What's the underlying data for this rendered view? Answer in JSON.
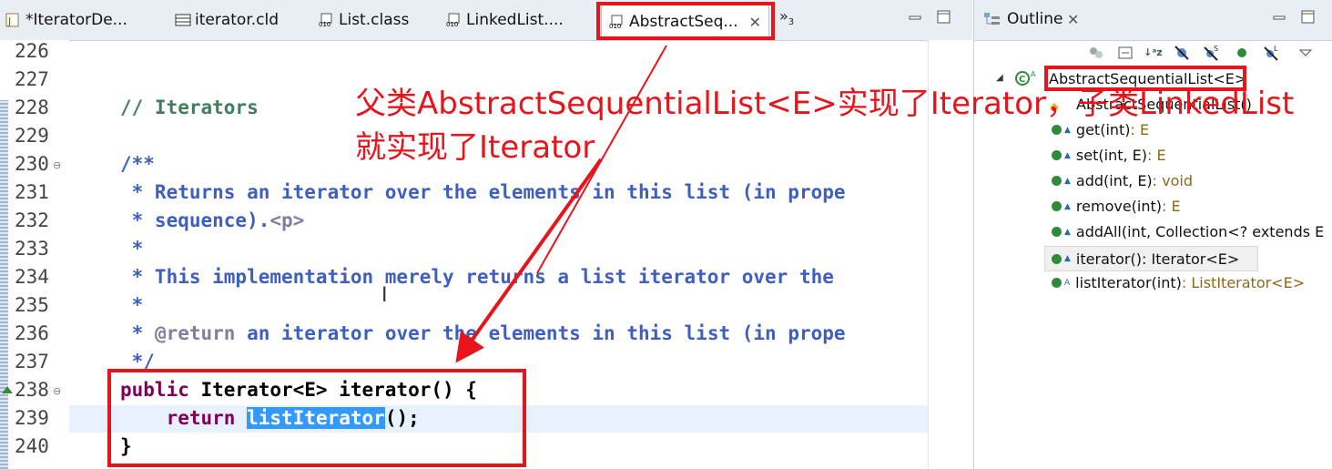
{
  "editor": {
    "tabs": [
      {
        "label": "*IteratorDe...",
        "icon": "java-file-icon"
      },
      {
        "label": "iterator.cld",
        "icon": "class-diagram-icon"
      },
      {
        "label": "List.class",
        "icon": "class-file-icon"
      },
      {
        "label": "LinkedList....",
        "icon": "class-file-icon"
      },
      {
        "label": "AbstractSeq...",
        "icon": "class-file-icon",
        "active": true
      }
    ],
    "close_glyph": "✕",
    "overflow": {
      "glyph": "»",
      "count": "3"
    },
    "lines": [
      {
        "n": "226",
        "text": ""
      },
      {
        "n": "227",
        "text": ""
      },
      {
        "n": "228",
        "text": "// Iterators"
      },
      {
        "n": "229",
        "text": ""
      },
      {
        "n": "230",
        "text": "/**",
        "fold": "⊖"
      },
      {
        "n": "231",
        "text": " * Returns an iterator over the elements in this list (in prope"
      },
      {
        "n": "232",
        "text_a": " * sequence).",
        "text_b": "<p>"
      },
      {
        "n": "233",
        "text": " *"
      },
      {
        "n": "234",
        "text": " * This implementation merely returns a list iterator over the"
      },
      {
        "n": "235",
        "text": " *"
      },
      {
        "n": "236",
        "text_a": " * ",
        "text_b": "@return",
        "text_c": " an iterator over the elements in this list (in prope"
      },
      {
        "n": "237",
        "text": " */"
      },
      {
        "n": "238",
        "kw": "public",
        "text": " Iterator<E> iterator() {",
        "fold": "⊖"
      },
      {
        "n": "239",
        "kw": "    return",
        "sel": "listIterator",
        "tail": "();"
      },
      {
        "n": "240",
        "text": "}"
      }
    ]
  },
  "outline": {
    "title": "Outline",
    "close_glyph": "✕",
    "class_name": "AbstractSequentialList<E>",
    "items": [
      {
        "name": "AbstractSequentialList()",
        "type": ""
      },
      {
        "name": "get(int)",
        "type": " : E"
      },
      {
        "name": "set(int, E)",
        "type": " : E"
      },
      {
        "name": "add(int, E)",
        "type": " : void"
      },
      {
        "name": "remove(int)",
        "type": " : E"
      },
      {
        "name": "addAll(int, Collection<? extends E",
        "type": ""
      },
      {
        "name": "iterator()",
        "type": " : Iterator<E>"
      },
      {
        "name": "listIterator(int)",
        "type": " : ListIterator<E>"
      }
    ]
  },
  "annotation": {
    "line1": "父类AbstractSequentialList<E>实现了Iterator，子类LinkedList",
    "line2": "就实现了Iterator",
    "color": "#e8141b"
  }
}
